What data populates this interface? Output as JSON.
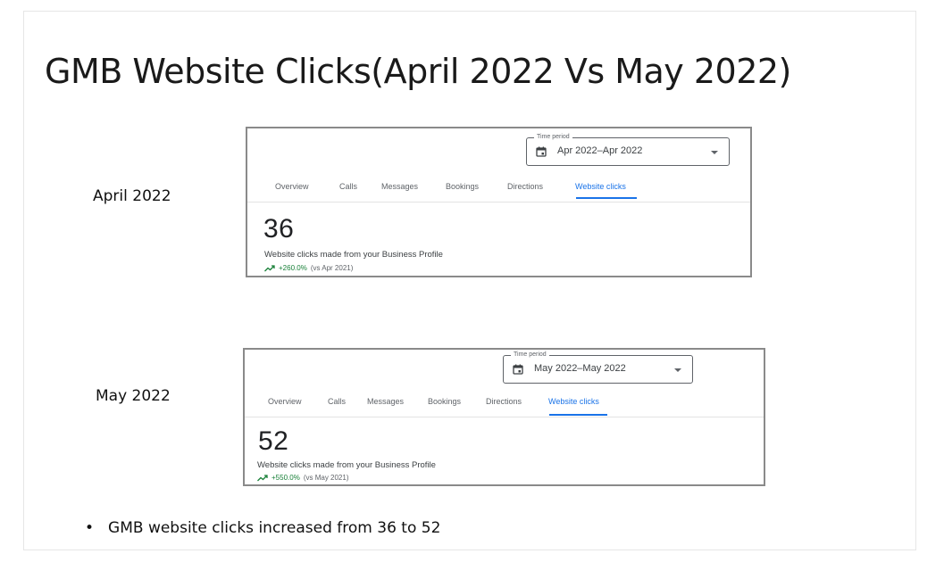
{
  "slide": {
    "title": "GMB Website Clicks(April 2022 Vs May 2022)",
    "bullet_text": "GMB website clicks increased from 36 to 52"
  },
  "panels": [
    {
      "period_label": "April 2022",
      "time_period_legend": "Time period",
      "time_period_value": "Apr 2022–Apr 2022",
      "tabs": [
        "Overview",
        "Calls",
        "Messages",
        "Bookings",
        "Directions",
        "Website clicks"
      ],
      "active_tab": "Website clicks",
      "metric_value": "36",
      "metric_description": "Website clicks made from your Business Profile",
      "change_percent": "+260.0%",
      "change_comparison": "(vs Apr 2021)"
    },
    {
      "period_label": "May 2022",
      "time_period_legend": "Time period",
      "time_period_value": "May 2022–May 2022",
      "tabs": [
        "Overview",
        "Calls",
        "Messages",
        "Bookings",
        "Directions",
        "Website clicks"
      ],
      "active_tab": "Website clicks",
      "metric_value": "52",
      "metric_description": "Website clicks made from your Business Profile",
      "change_percent": "+550.0%",
      "change_comparison": "(vs May 2021)"
    }
  ],
  "colors": {
    "accent_blue": "#1a73e8",
    "positive_green": "#188038"
  },
  "icons": {
    "calendar": "calendar-icon",
    "dropdown": "chevron-down-icon",
    "trend": "trending-up-icon"
  }
}
